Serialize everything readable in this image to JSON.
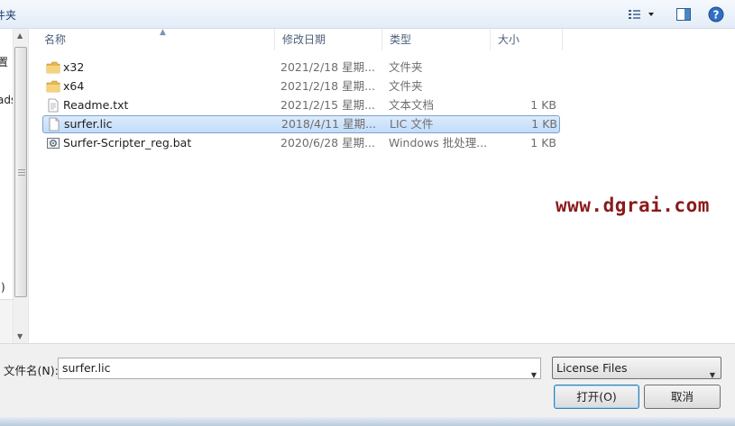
{
  "toolbar": {
    "title": "件夹",
    "icons": [
      "view-options-icon",
      "preview-pane-icon",
      "help-icon"
    ]
  },
  "nav": {
    "items": [
      "置",
      "ads",
      ":)"
    ]
  },
  "list": {
    "columns": {
      "name": "名称",
      "date": "修改日期",
      "type": "类型",
      "size": "大小"
    },
    "rows": [
      {
        "name": "x32",
        "date": "2021/2/18 星期...",
        "type": "文件夹",
        "size": "",
        "icon": "folder-icon"
      },
      {
        "name": "x64",
        "date": "2021/2/18 星期...",
        "type": "文件夹",
        "size": "",
        "icon": "folder-icon"
      },
      {
        "name": "Readme.txt",
        "date": "2021/2/15 星期...",
        "type": "文本文档",
        "size": "1 KB",
        "icon": "text-file-icon"
      },
      {
        "name": "surfer.lic",
        "date": "2018/4/11 星期...",
        "type": "LIC 文件",
        "size": "1 KB",
        "icon": "generic-file-icon",
        "selected": true
      },
      {
        "name": "Surfer-Scripter_reg.bat",
        "date": "2020/6/28 星期...",
        "type": "Windows 批处理...",
        "size": "1 KB",
        "icon": "batch-file-icon"
      }
    ]
  },
  "watermark": "www.dgrai.com",
  "bottom": {
    "filename_label": "文件名(N):",
    "filename_value": "surfer.lic",
    "filter_value": "License Files",
    "open_label": "打开(O)",
    "cancel_label": "取消"
  },
  "colors": {
    "selection": "#c1dcfb",
    "folder": "#e8b84a",
    "watermark": "#8b1a1a"
  }
}
